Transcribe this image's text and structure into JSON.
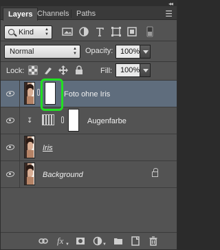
{
  "tabs": [
    {
      "label": "Layers",
      "active": true
    },
    {
      "label": "Channels",
      "active": false
    },
    {
      "label": "Paths",
      "active": false
    }
  ],
  "filter": {
    "kind_label": "Kind",
    "icons": [
      "pixel-filter-icon",
      "adjustment-filter-icon",
      "type-filter-icon",
      "shape-filter-icon",
      "smart-object-filter-icon",
      "filter-toggle-icon"
    ]
  },
  "blend": {
    "mode": "Normal",
    "opacity_label": "Opacity:",
    "opacity_value": "100%"
  },
  "lock": {
    "label": "Lock:",
    "icons": [
      "lock-transparent-icon",
      "lock-image-icon",
      "lock-position-icon",
      "lock-all-icon"
    ],
    "fill_label": "Fill:",
    "fill_value": "100%"
  },
  "layers": [
    {
      "name": "Foto ohne Iris",
      "selected": true,
      "has_mask": true,
      "visible": true
    },
    {
      "name": "Augenfarbe",
      "clipped": true,
      "adjustment": true,
      "has_mask": true,
      "visible": true
    },
    {
      "name": "Iris",
      "visible": true
    },
    {
      "name": "Background",
      "locked": true,
      "visible": true
    }
  ],
  "highlight_color": "#22e022",
  "selection_color": "#5f6d7d",
  "bottom_icons": [
    "link-layers-icon",
    "fx-icon",
    "add-mask-icon",
    "new-adjustment-icon",
    "new-group-icon",
    "new-layer-icon",
    "delete-layer-icon"
  ]
}
